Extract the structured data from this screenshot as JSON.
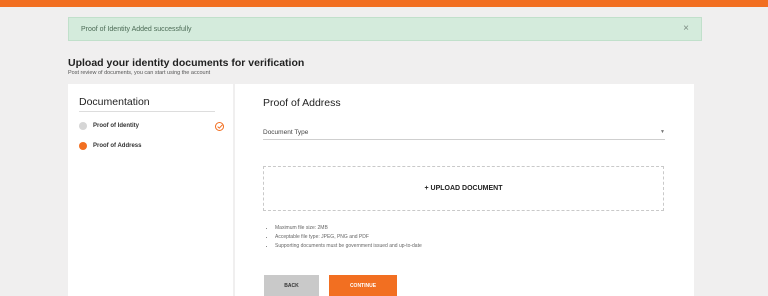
{
  "colors": {
    "accent": "#f26f21"
  },
  "alert": {
    "message": "Proof of Identity Added successfully",
    "close_icon": "close-icon",
    "close_glyph": "×"
  },
  "page": {
    "heading": "Upload your identity documents for verification",
    "subheading": "Post review of documents, you can start using the account"
  },
  "sidebar": {
    "title": "Documentation",
    "steps": [
      {
        "label": "Proof of Identity",
        "status": "completed"
      },
      {
        "label": "Proof of Address",
        "status": "active"
      }
    ]
  },
  "main": {
    "title": "Proof of Address",
    "document_type": {
      "placeholder": "Document Type",
      "caret": "▼"
    },
    "upload_label": "+ UPLOAD DOCUMENT",
    "notes": [
      "Maximum file size: 2MB",
      "Acceptable file type: JPEG, PNG and PDF",
      "Supporting documents must be government issued and up-to-date"
    ],
    "back_label": "BACK",
    "continue_label": "CONTINUE"
  }
}
